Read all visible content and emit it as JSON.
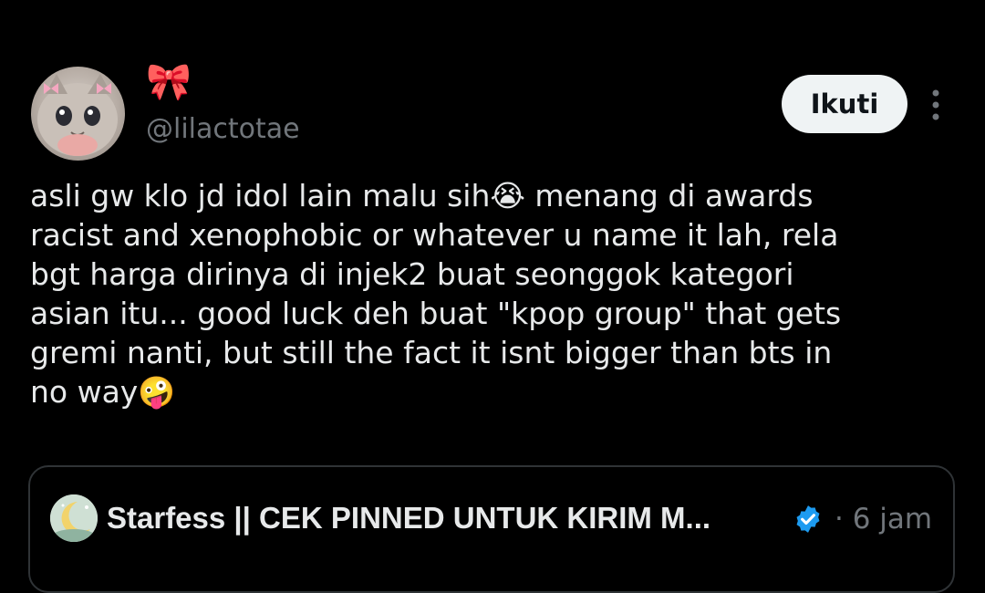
{
  "author": {
    "display_name": "🎀",
    "handle": "@lilactotae"
  },
  "follow_button": {
    "label": "Ikuti"
  },
  "tweet": {
    "text": "asli gw klo jd idol lain malu sih😭 menang di awards\nracist and xenophobic or whatever u name it lah, rela\nbgt harga dirinya di injek2 buat seonggok kategori\nasian itu... good luck deh buat \"kpop group\" that gets\ngremi nanti, but still the fact it isnt bigger than bts in\nno way🤪"
  },
  "quoted_tweet": {
    "author_name": "Starfess || CEK PINNED UNTUK KIRIM M...",
    "time": "· 6 jam"
  },
  "colors": {
    "background": "#000000",
    "text_primary": "#e7e9ea",
    "text_secondary": "#71767b",
    "follow_button_bg": "#eff3f4",
    "verified_badge": "#1d9bf0",
    "border": "#2f3336"
  },
  "icons": {
    "more": "vertical-ellipsis-icon",
    "verified": "verified-badge-icon"
  }
}
